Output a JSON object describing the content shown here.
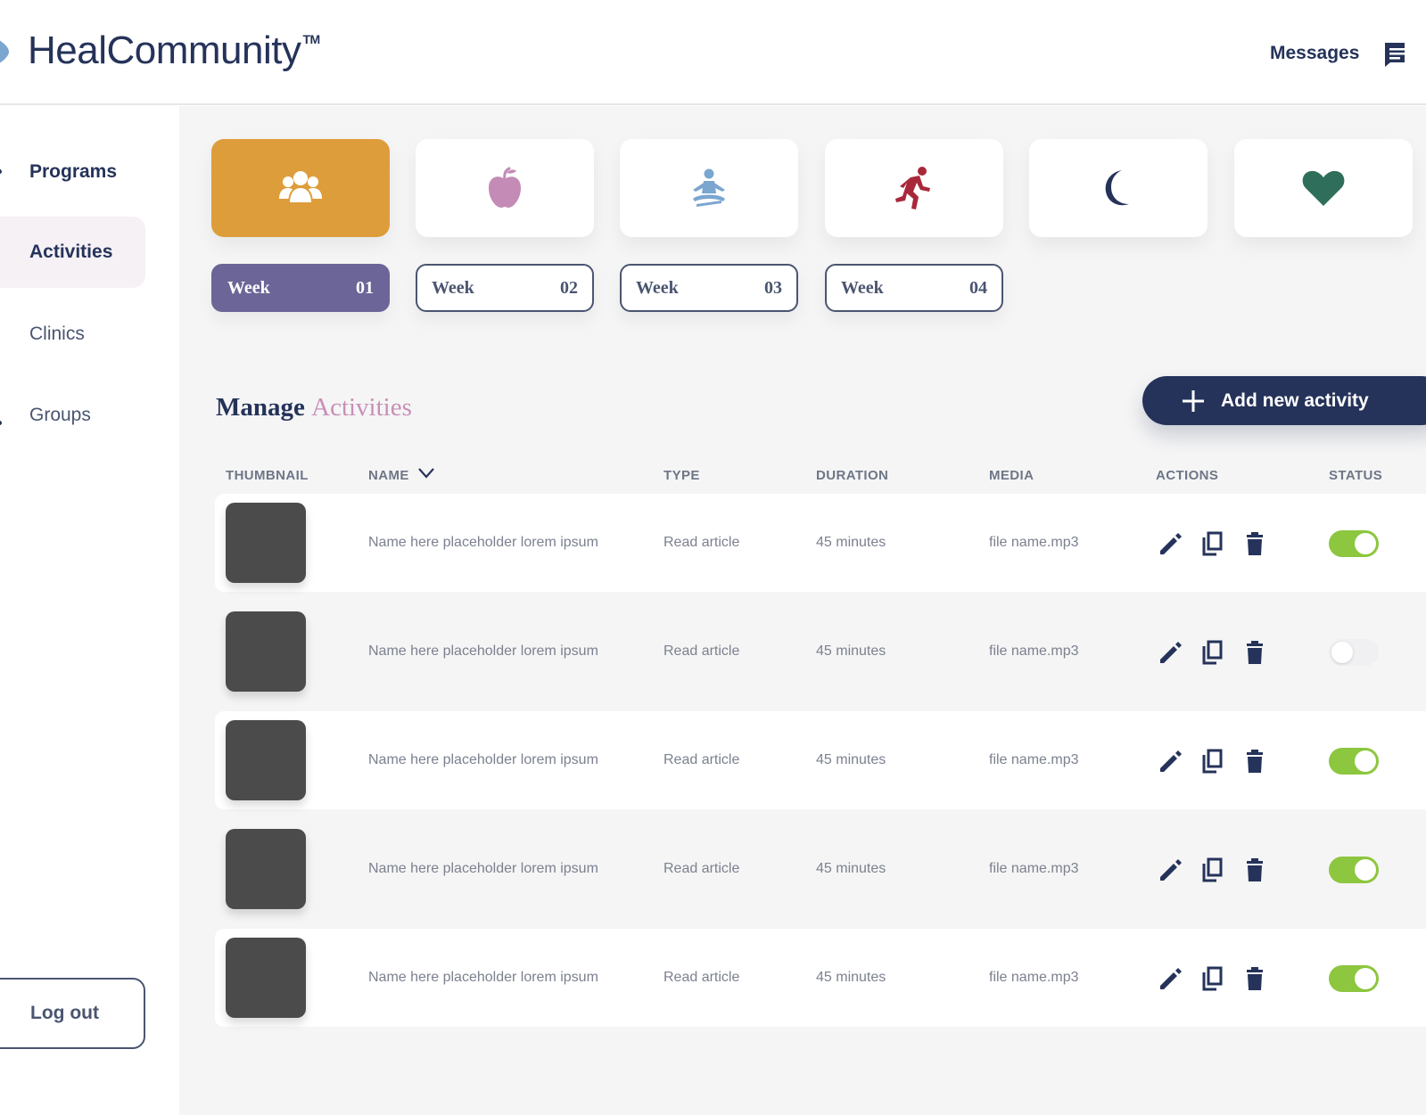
{
  "header": {
    "app_name": "HealCommunity",
    "trademark": "TM",
    "messages_label": "Messages"
  },
  "sidebar": {
    "items": [
      {
        "label": "Programs"
      },
      {
        "label": "Activities"
      },
      {
        "label": "Clinics"
      },
      {
        "label": "Groups"
      }
    ],
    "logout_label": "Log out"
  },
  "categories": [
    {
      "icon": "group-icon",
      "color": "#ffffff",
      "selected": true
    },
    {
      "icon": "apple-icon",
      "color": "#c48bb6",
      "selected": false
    },
    {
      "icon": "meditation-icon",
      "color": "#7ba6d0",
      "selected": false
    },
    {
      "icon": "running-icon",
      "color": "#a8283a",
      "selected": false
    },
    {
      "icon": "moon-icon",
      "color": "#25335a",
      "selected": false
    },
    {
      "icon": "heart-icon",
      "color": "#2f6e5a",
      "selected": false
    }
  ],
  "weeks": [
    {
      "label": "Week",
      "number": "01",
      "selected": true
    },
    {
      "label": "Week",
      "number": "02",
      "selected": false
    },
    {
      "label": "Week",
      "number": "03",
      "selected": false
    },
    {
      "label": "Week",
      "number": "04",
      "selected": false
    }
  ],
  "manage": {
    "title_main": "Manage",
    "title_accent": "Activities",
    "add_button_label": "Add new activity"
  },
  "table": {
    "columns": [
      "THUMBNAIL",
      "NAME",
      "TYPE",
      "DURATION",
      "MEDIA",
      "ACTIONS",
      "STATUS"
    ],
    "rows": [
      {
        "name": "Name here placeholder lorem ipsum",
        "type": "Read article",
        "duration": "45 minutes",
        "media": "file name.mp3",
        "status_on": true
      },
      {
        "name": "Name here placeholder lorem ipsum",
        "type": "Read article",
        "duration": "45 minutes",
        "media": "file name.mp3",
        "status_on": false
      },
      {
        "name": "Name here placeholder lorem ipsum",
        "type": "Read article",
        "duration": "45 minutes",
        "media": "file name.mp3",
        "status_on": true
      },
      {
        "name": "Name here placeholder lorem ipsum",
        "type": "Read article",
        "duration": "45 minutes",
        "media": "file name.mp3",
        "status_on": true
      },
      {
        "name": "Name here placeholder lorem ipsum",
        "type": "Read article",
        "duration": "45 minutes",
        "media": "file name.mp3",
        "status_on": true
      }
    ]
  },
  "colors": {
    "navy": "#25335a",
    "orange": "#de9d3b",
    "purple": "#6b6697",
    "pink_accent": "#c88fb8",
    "toggle_on": "#8dc63f",
    "thumbnail": "#4b4b4b"
  }
}
